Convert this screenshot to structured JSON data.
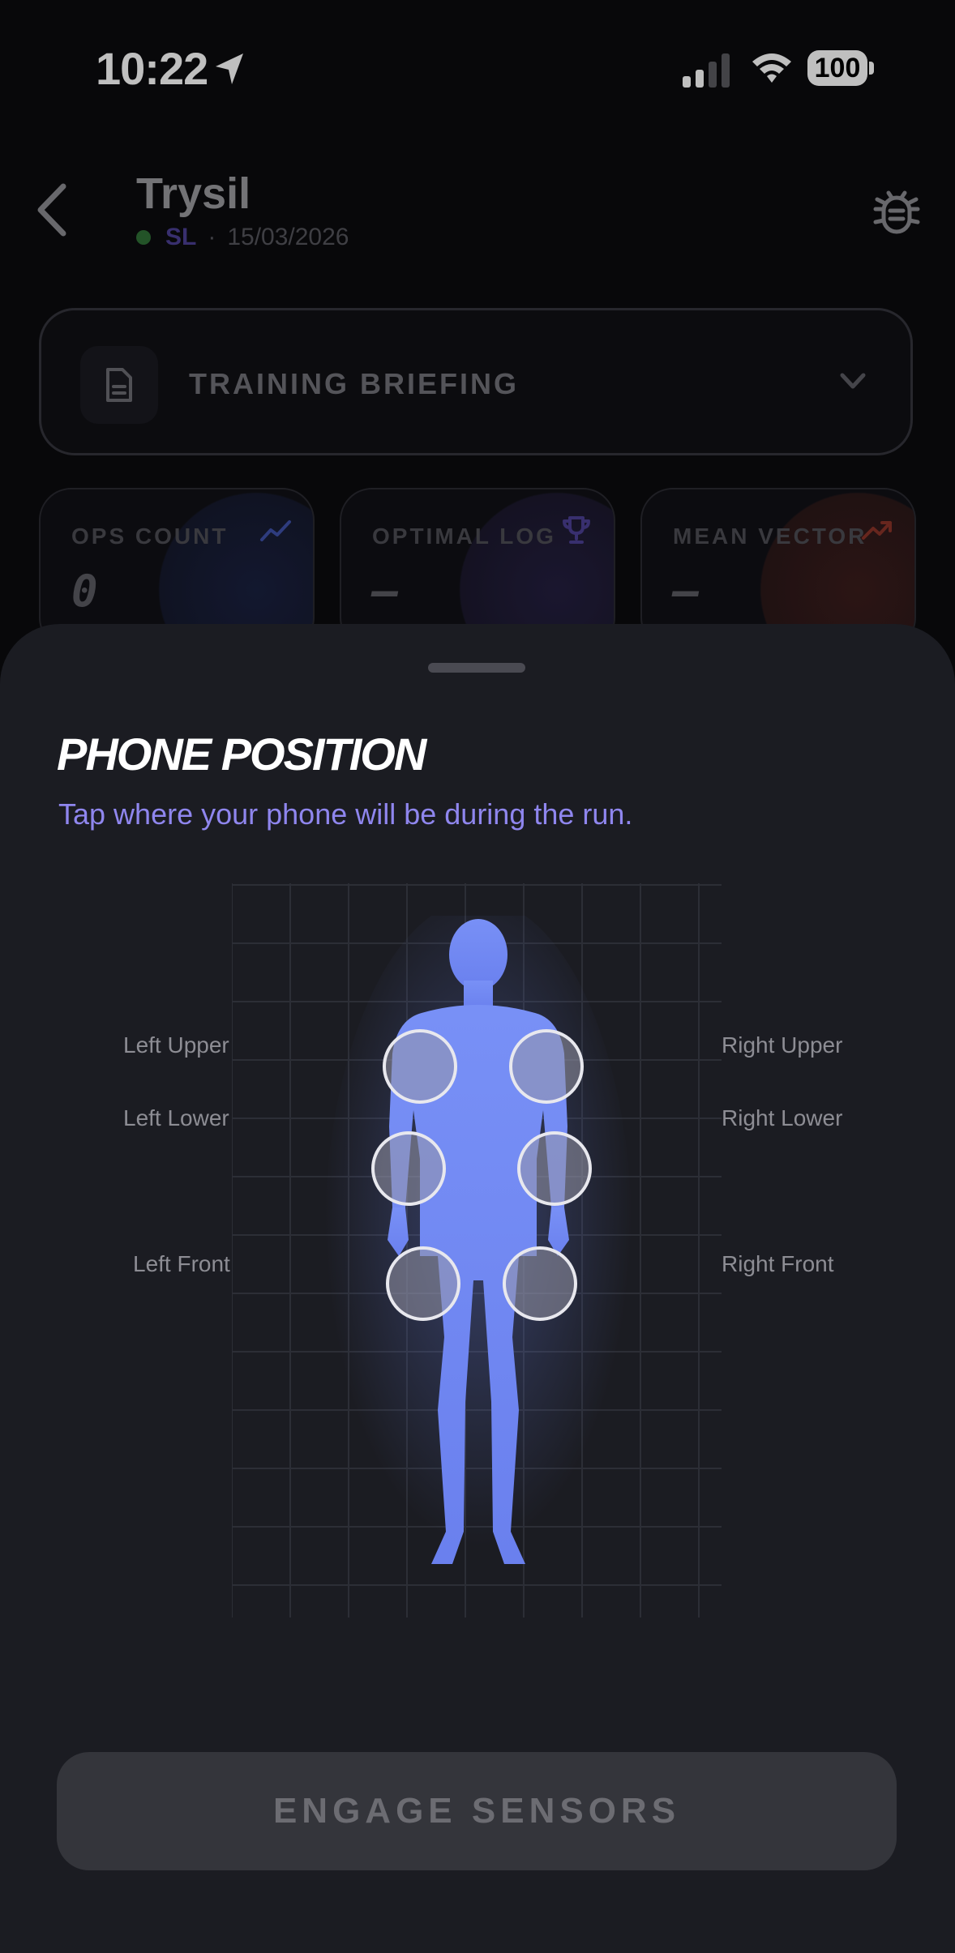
{
  "status_bar": {
    "time": "10:22",
    "battery": "100"
  },
  "header": {
    "title": "Trysil",
    "code": "SL",
    "separator": "·",
    "date": "15/03/2026"
  },
  "briefing": {
    "label": "TRAINING BRIEFING"
  },
  "stats": [
    {
      "label": "OPS COUNT",
      "value": "0",
      "icon": "trend-line-icon",
      "color": "#3e50a8"
    },
    {
      "label": "OPTIMAL LOG",
      "value": "—",
      "icon": "trophy-icon",
      "color": "#4b3f93"
    },
    {
      "label": "MEAN VECTOR",
      "value": "—",
      "icon": "trending-up-icon",
      "color": "#8a3328"
    }
  ],
  "sheet": {
    "title": "PHONE POSITION",
    "subtitle": "Tap where your phone will be during the run.",
    "labels": {
      "left_upper": "Left Upper",
      "left_lower": "Left Lower",
      "left_front": "Left Front",
      "right_upper": "Right Upper",
      "right_lower": "Right Lower",
      "right_front": "Right Front"
    },
    "button": "ENGAGE SENSORS"
  },
  "colors": {
    "accent": "#8f86ee",
    "body": "#6f88f5",
    "sheet_bg": "#1b1c22"
  }
}
